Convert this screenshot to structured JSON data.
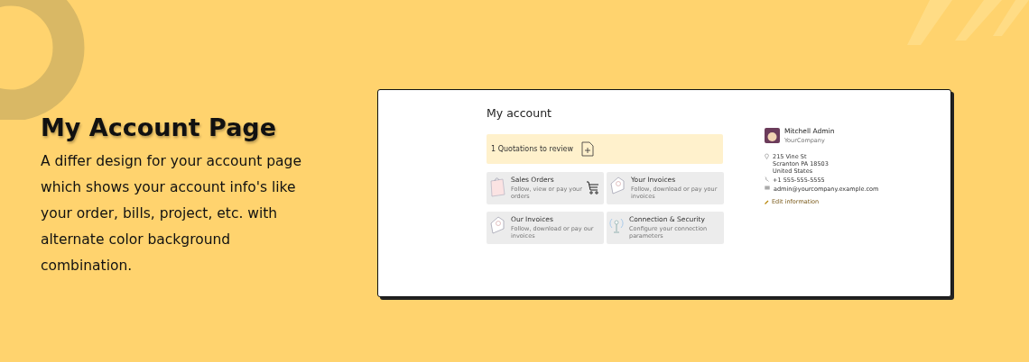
{
  "hero": {
    "title": "My Account Page",
    "description": "A differ design for your account page which shows your account info's like your order, bills, project, etc. with alternate color background combination."
  },
  "portal": {
    "heading": "My account",
    "banner": {
      "text": "1 Quotations to review"
    },
    "tiles": [
      {
        "kind": "orders",
        "title": "Sales Orders",
        "subtitle": "Follow, view or pay your orders"
      },
      {
        "kind": "invoices",
        "title": "Your Invoices",
        "subtitle": "Follow, download or pay your invoices"
      },
      {
        "kind": "invoices",
        "title": "Our Invoices",
        "subtitle": "Follow, download or pay our invoices"
      },
      {
        "kind": "security",
        "title": "Connection & Security",
        "subtitle": "Configure your connection parameters"
      }
    ],
    "profile": {
      "name": "Mitchell Admin",
      "company": "YourCompany",
      "address": [
        "215 Vine St",
        "Scranton PA 18503",
        "United States"
      ],
      "phone": "+1 555-555-5555",
      "email": "admin@yourcompany.example.com",
      "edit_link": "Edit information"
    }
  }
}
